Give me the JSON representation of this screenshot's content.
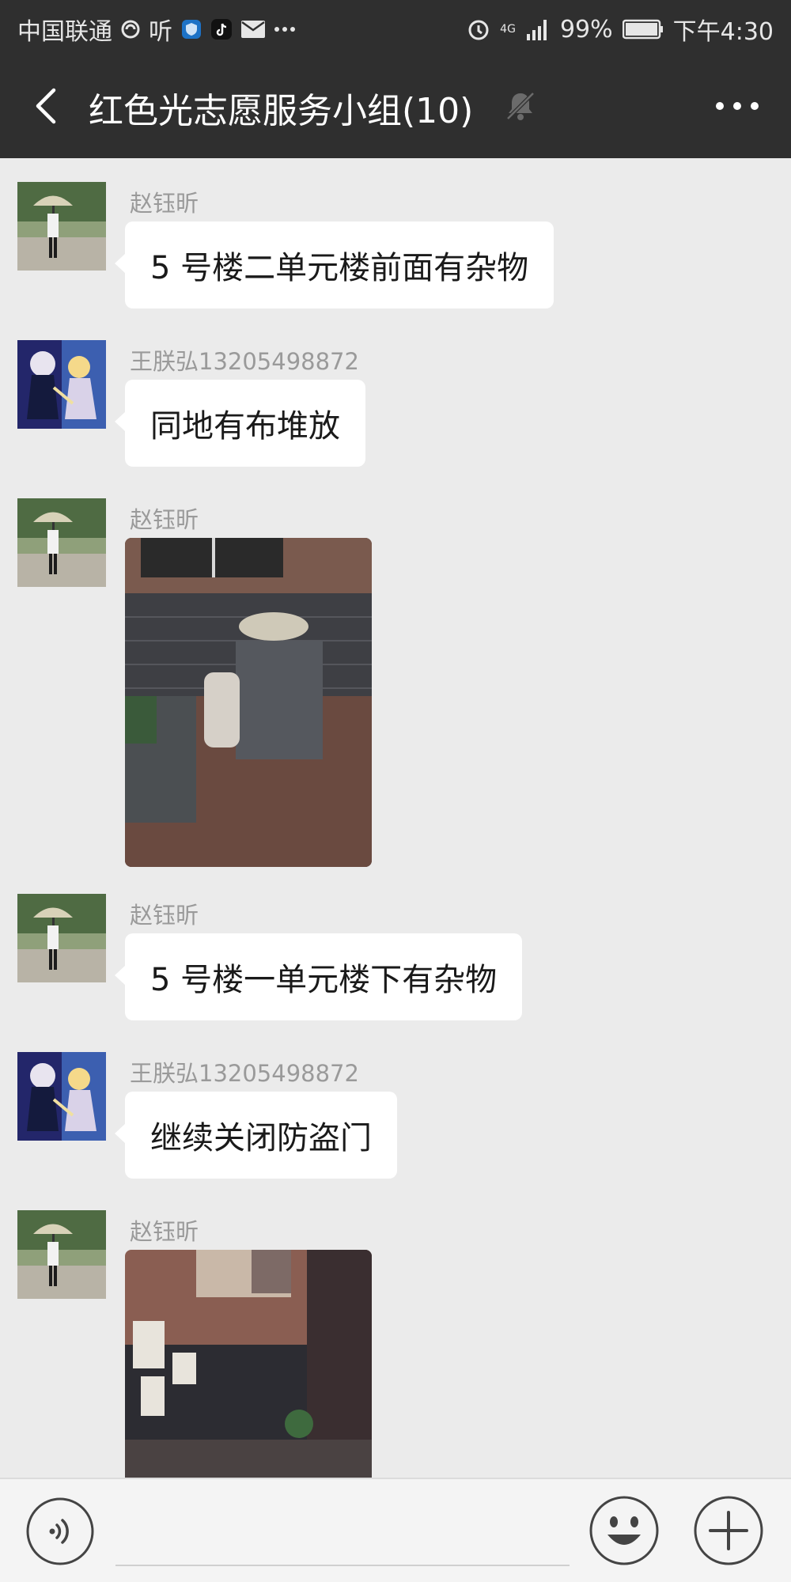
{
  "status_bar": {
    "carrier": "中国联通",
    "listen_label": "听",
    "network": "4G",
    "battery": "99%",
    "time": "下午4:30"
  },
  "nav": {
    "title": "红色光志愿服务小组(10)"
  },
  "messages": [
    {
      "sender": "赵钰昕",
      "type": "text",
      "text": "5 号楼二单元楼前面有杂物"
    },
    {
      "sender": "王朕弘13205498872",
      "type": "text",
      "text": "同地有布堆放"
    },
    {
      "sender": "赵钰昕",
      "type": "image"
    },
    {
      "sender": "赵钰昕",
      "type": "text",
      "text": "5 号楼一单元楼下有杂物"
    },
    {
      "sender": "王朕弘13205498872",
      "type": "text",
      "text": "继续关闭防盗门"
    },
    {
      "sender": "赵钰昕",
      "type": "image"
    }
  ],
  "icons": {
    "back": "chevron-left-icon",
    "mute": "bell-muted-icon",
    "more": "more-dots-icon",
    "voice": "voice-icon",
    "emoji": "smiley-icon",
    "plus": "plus-icon"
  },
  "colors": {
    "header_bg": "#2f2f2f",
    "chat_bg": "#ebebeb",
    "bubble_bg": "#ffffff",
    "sender_text": "#9a9a9a"
  }
}
